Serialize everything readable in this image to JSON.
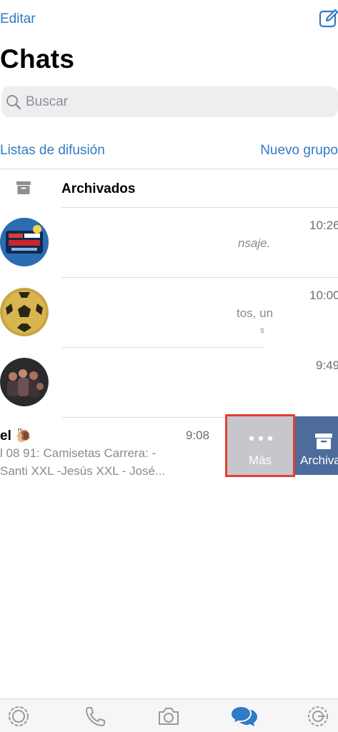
{
  "header": {
    "edit_label": "Editar",
    "title": "Chats"
  },
  "search": {
    "placeholder": "Buscar"
  },
  "links": {
    "broadcast": "Listas de difusión",
    "new_group": "Nuevo grupo"
  },
  "archived": {
    "label": "Archivados"
  },
  "chats": [
    {
      "time": "10:26",
      "snippet": "nsaje."
    },
    {
      "time": "10:00",
      "snippet": "tos, un",
      "snippet2": "s"
    },
    {
      "time": "9:49"
    },
    {
      "name": "el 🐌",
      "time": "9:08",
      "line1": "l 08 91: Camisetas Carrera: -",
      "line2": "Santi XXL -Jesús XXL - José..."
    }
  ],
  "swipe_actions": {
    "more": "Más",
    "archive": "Archivar"
  },
  "colors": {
    "accent": "#2f7bc4",
    "more_bg": "#c6c6cc",
    "archive_bg": "#4d6b9b",
    "highlight": "#e0412f"
  }
}
